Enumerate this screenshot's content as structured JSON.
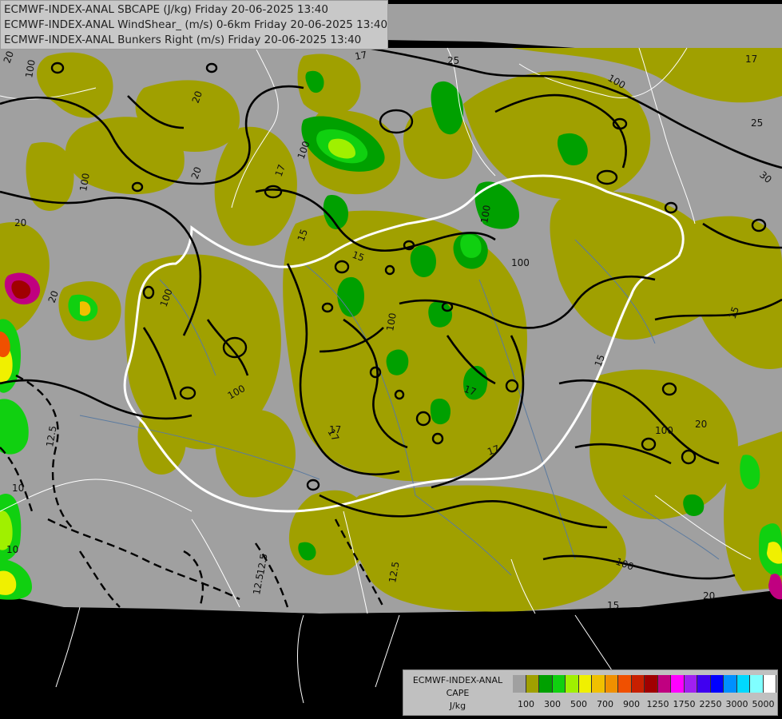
{
  "header": {
    "lines": [
      "ECMWF-INDEX-ANAL SBCAPE (J/kg) Friday 20-06-2025 13:40",
      "ECMWF-INDEX-ANAL WindShear_ (m/s) 0-6km Friday 20-06-2025 13:40",
      "ECMWF-INDEX-ANAL Bunkers Right (m/s) Friday 20-06-2025 13:40"
    ]
  },
  "legend": {
    "title_lines": [
      "ECMWF-INDEX-ANAL",
      "CAPE",
      "J/kg"
    ],
    "tick_labels": [
      "100",
      "300",
      "500",
      "700",
      "900",
      "1250",
      "1750",
      "2250",
      "3000",
      "5000"
    ],
    "colors": [
      "#a0a0a0",
      "#a0a000",
      "#00a000",
      "#10d010",
      "#a0f000",
      "#f0f000",
      "#f0c000",
      "#f09000",
      "#f05000",
      "#c82000",
      "#a00000",
      "#c00080",
      "#ff00ff",
      "#a020f0",
      "#4000f0",
      "#0000ff",
      "#0090ff",
      "#00d8ff",
      "#80ffff",
      "#ffffff"
    ]
  },
  "map_labels": {
    "contours": [
      "20",
      "17",
      "25",
      "15",
      "100",
      "20",
      "25",
      "17",
      "30",
      "20",
      "20",
      "20",
      "17",
      "15",
      "100",
      "100",
      "100",
      "17",
      "15",
      "15",
      "17",
      "17",
      "12.5",
      "12.5",
      "12.5",
      "10",
      "10",
      "20",
      "100",
      "100",
      "15",
      "100",
      "20",
      "17",
      "12.5",
      "100",
      "100",
      "100",
      "100"
    ]
  },
  "colors": {
    "background": "#000000",
    "land_low": "#a0a0a0",
    "cape_100": "#a0a000",
    "cape_300": "#00a000",
    "cape_500": "#10d010",
    "border": "#ffffff"
  }
}
